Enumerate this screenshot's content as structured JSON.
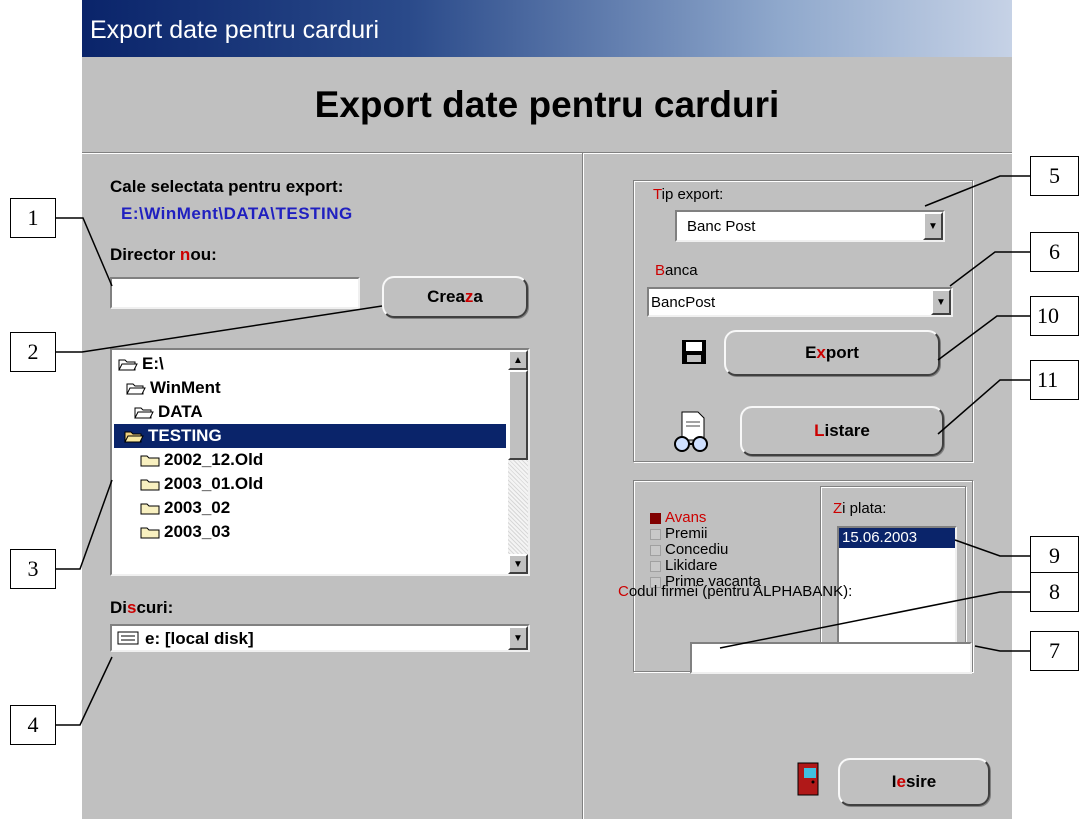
{
  "window": {
    "title": "Export date pentru carduri"
  },
  "heading": "Export date pentru carduri",
  "left": {
    "selected_path_label": "Cale selectata pentru export:",
    "selected_path": "E:\\WinMent\\DATA\\TESTING",
    "new_dir_label": {
      "pre": "Director ",
      "hot": "n",
      "post": "ou:"
    },
    "new_dir_value": "",
    "create_button": {
      "pre": "Crea",
      "hot": "z",
      "post": "a"
    },
    "tree": [
      {
        "label": "E:\\",
        "open": true,
        "selected": false
      },
      {
        "label": "WinMent",
        "open": true,
        "selected": false
      },
      {
        "label": "DATA",
        "open": true,
        "selected": false
      },
      {
        "label": "TESTING",
        "open": true,
        "selected": true
      },
      {
        "label": "2002_12.Old",
        "open": false,
        "selected": false
      },
      {
        "label": "2003_01.Old",
        "open": false,
        "selected": false
      },
      {
        "label": "2003_02",
        "open": false,
        "selected": false
      },
      {
        "label": "2003_03",
        "open": false,
        "selected": false
      }
    ],
    "disks_label": {
      "pre": "Di",
      "hot": "s",
      "post": "curi:"
    },
    "disk_value": "e: [local disk]"
  },
  "right": {
    "tip_export_label": {
      "hot": "T",
      "post": "ip export:"
    },
    "tip_export_value": "Banc Post",
    "banca_label": {
      "hot": "B",
      "post": "anca"
    },
    "banca_value": "BancPost",
    "export_button": {
      "pre": "E",
      "hot": "x",
      "post": "port"
    },
    "listare_button": {
      "hot": "L",
      "post": "istare"
    },
    "checks": [
      {
        "label": "Avans",
        "checked": true
      },
      {
        "label": "Premii",
        "checked": false
      },
      {
        "label": "Concediu",
        "checked": false
      },
      {
        "label": "Likidare",
        "checked": false
      },
      {
        "label": "Prime vacanta",
        "checked": false
      }
    ],
    "zi_plata_label": {
      "hot": "Z",
      "post": "i plata:"
    },
    "zi_plata_items": [
      "15.06.2003"
    ],
    "codul_label": {
      "hot": "C",
      "post": "odul firmei (pentru ALPHABANK):"
    },
    "codul_value": "",
    "iesire_button": {
      "pre": "I",
      "hot": "e",
      "post": "sire"
    }
  },
  "callouts": [
    "1",
    "2",
    "3",
    "4",
    "5",
    "6",
    "10",
    "11",
    "9",
    "8",
    "7"
  ],
  "colors": {
    "title_start": "#0a246a",
    "selection": "#0a246a",
    "accent_red": "#cc0000",
    "path_blue": "#2020c0",
    "face": "#c0c0c0"
  },
  "icons": [
    "folder-open-icon",
    "folder-closed-icon",
    "disk-drive-icon",
    "floppy-disk-icon",
    "print-preview-icon",
    "door-exit-icon"
  ]
}
